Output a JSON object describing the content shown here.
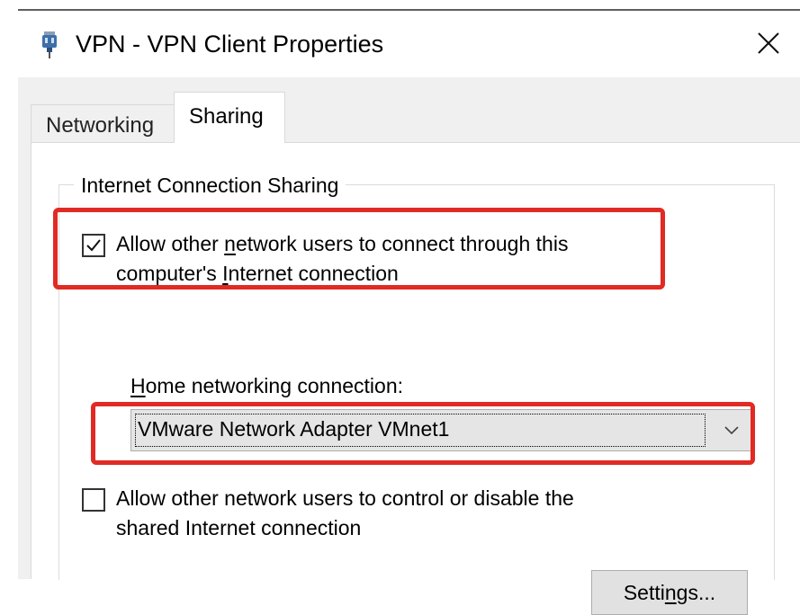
{
  "window": {
    "title": "VPN - VPN Client Properties",
    "icon": "network-adapter-icon",
    "close_icon": "close-icon"
  },
  "tabs": [
    {
      "label": "Networking",
      "selected": false
    },
    {
      "label": "Sharing",
      "selected": true
    }
  ],
  "sharing": {
    "group_title": "Internet Connection Sharing",
    "allow_connect": {
      "checked": true,
      "line1_before": "Allow other ",
      "line1_underlined": "n",
      "line1_after": "etwork users to connect through this",
      "line2_before": "computer's ",
      "line2_underlined": "I",
      "line2_after": "nternet connection"
    },
    "home_connection": {
      "label_underlined": "H",
      "label_rest": "ome networking connection:",
      "selected_value": "VMware Network Adapter VMnet1",
      "arrow_icon": "chevron-down-icon"
    },
    "allow_control": {
      "checked": false,
      "line1": "Allow other network users to control or disable the",
      "line2": "shared Internet connection"
    },
    "settings_button": {
      "label_before": "Setti",
      "label_underlined": "n",
      "label_after": "gs..."
    }
  },
  "colors": {
    "highlight": "#e12a24",
    "dialog_bg": "#f0f0f0",
    "panel_bg": "#ffffff",
    "button_bg": "#e1e1e1"
  }
}
